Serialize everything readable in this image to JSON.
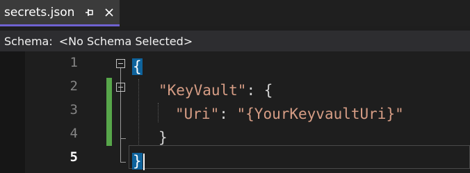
{
  "tab": {
    "label": "secrets.json",
    "pin_icon": "pin-icon",
    "close_icon": "close-icon",
    "accent": "#6f62d0"
  },
  "schema": {
    "label": "Schema:",
    "value": "<No Schema Selected>"
  },
  "editor": {
    "line_numbers": [
      "1",
      "2",
      "3",
      "4",
      "5"
    ],
    "current_line": 5,
    "lines": {
      "l1_brace": "{",
      "l2_key": "\"KeyVault\"",
      "l2_colon": ": ",
      "l2_brace": "{",
      "l3_key": "\"Uri\"",
      "l3_colon": ": ",
      "l3_value": "\"{YourKeyvaultUri}\"",
      "l4_brace": "}",
      "l5_brace": "}"
    },
    "colors": {
      "string": "#d69d85",
      "change_marker": "#57a64a",
      "brace_highlight": "#0e639c"
    }
  }
}
